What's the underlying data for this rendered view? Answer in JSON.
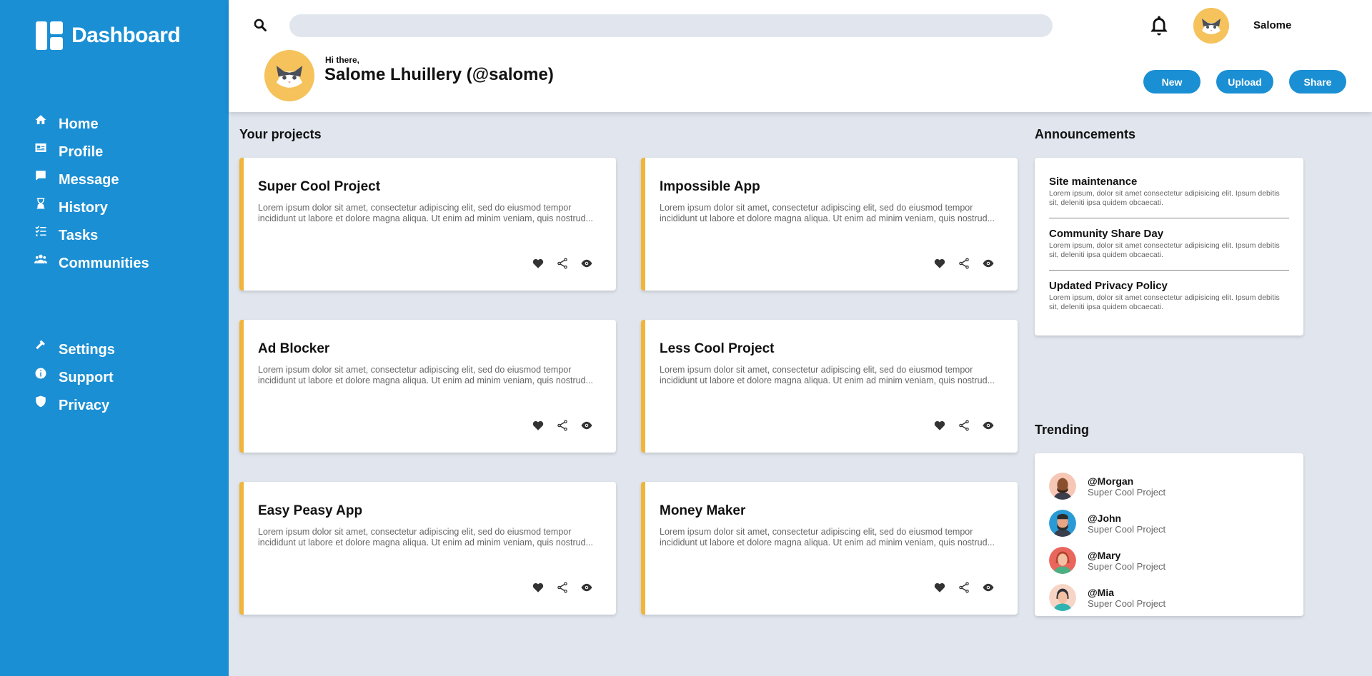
{
  "brand": {
    "title": "Dashboard"
  },
  "sidebar": {
    "main_items": [
      {
        "label": "Home",
        "icon": "home-icon"
      },
      {
        "label": "Profile",
        "icon": "id-card-icon"
      },
      {
        "label": "Message",
        "icon": "message-icon"
      },
      {
        "label": "History",
        "icon": "hourglass-icon"
      },
      {
        "label": "Tasks",
        "icon": "tasks-icon"
      },
      {
        "label": "Communities",
        "icon": "users-icon"
      }
    ],
    "secondary_items": [
      {
        "label": "Settings",
        "icon": "hammer-icon"
      },
      {
        "label": "Support",
        "icon": "info-icon"
      },
      {
        "label": "Privacy",
        "icon": "shield-icon"
      }
    ]
  },
  "header": {
    "search": {
      "value": "",
      "placeholder": ""
    },
    "user_name": "Salome",
    "greeting": "Hi there,",
    "full_name": "Salome Lhuillery (@salome)",
    "buttons": {
      "new": "New",
      "upload": "Upload",
      "share": "Share"
    }
  },
  "projects": {
    "title": "Your projects",
    "items": [
      {
        "title": "Super Cool Project",
        "description": "Lorem ipsum dolor sit amet, consectetur adipiscing elit, sed do eiusmod tempor incididunt ut labore et dolore magna aliqua. Ut enim ad minim veniam, quis nostrud..."
      },
      {
        "title": "Impossible App",
        "description": "Lorem ipsum dolor sit amet, consectetur adipiscing elit, sed do eiusmod tempor incididunt ut labore et dolore magna aliqua. Ut enim ad minim veniam, quis nostrud..."
      },
      {
        "title": "Ad Blocker",
        "description": "Lorem ipsum dolor sit amet, consectetur adipiscing elit, sed do eiusmod tempor incididunt ut labore et dolore magna aliqua. Ut enim ad minim veniam, quis nostrud..."
      },
      {
        "title": "Less Cool Project",
        "description": "Lorem ipsum dolor sit amet, consectetur adipiscing elit, sed do eiusmod tempor incididunt ut labore et dolore magna aliqua. Ut enim ad minim veniam, quis nostrud..."
      },
      {
        "title": "Easy Peasy App",
        "description": "Lorem ipsum dolor sit amet, consectetur adipiscing elit, sed do eiusmod tempor incididunt ut labore et dolore magna aliqua. Ut enim ad minim veniam, quis nostrud..."
      },
      {
        "title": "Money Maker",
        "description": "Lorem ipsum dolor sit amet, consectetur adipiscing elit, sed do eiusmod tempor incididunt ut labore et dolore magna aliqua. Ut enim ad minim veniam, quis nostrud..."
      }
    ]
  },
  "announcements": {
    "title": "Announcements",
    "items": [
      {
        "title": "Site maintenance",
        "description": "Lorem ipsum, dolor sit amet consectetur adipisicing elit. Ipsum debitis sit, deleniti ipsa quidem obcaecati."
      },
      {
        "title": "Community Share Day",
        "description": "Lorem ipsum, dolor sit amet consectetur adipisicing elit. Ipsum debitis sit, deleniti ipsa quidem obcaecati."
      },
      {
        "title": "Updated Privacy Policy",
        "description": "Lorem ipsum, dolor sit amet consectetur adipisicing elit. Ipsum debitis sit, deleniti ipsa quidem obcaecati."
      }
    ]
  },
  "trending": {
    "title": "Trending",
    "items": [
      {
        "handle": "@Morgan",
        "project": "Super Cool Project"
      },
      {
        "handle": "@John",
        "project": "Super Cool Project"
      },
      {
        "handle": "@Mary",
        "project": "Super Cool Project"
      },
      {
        "handle": "@Mia",
        "project": "Super Cool Project"
      }
    ]
  },
  "colors": {
    "sidebar": "#1b8fd4",
    "accent": "#f0b53a",
    "background": "#e1e6ee",
    "avatar": "#f5c25c"
  }
}
